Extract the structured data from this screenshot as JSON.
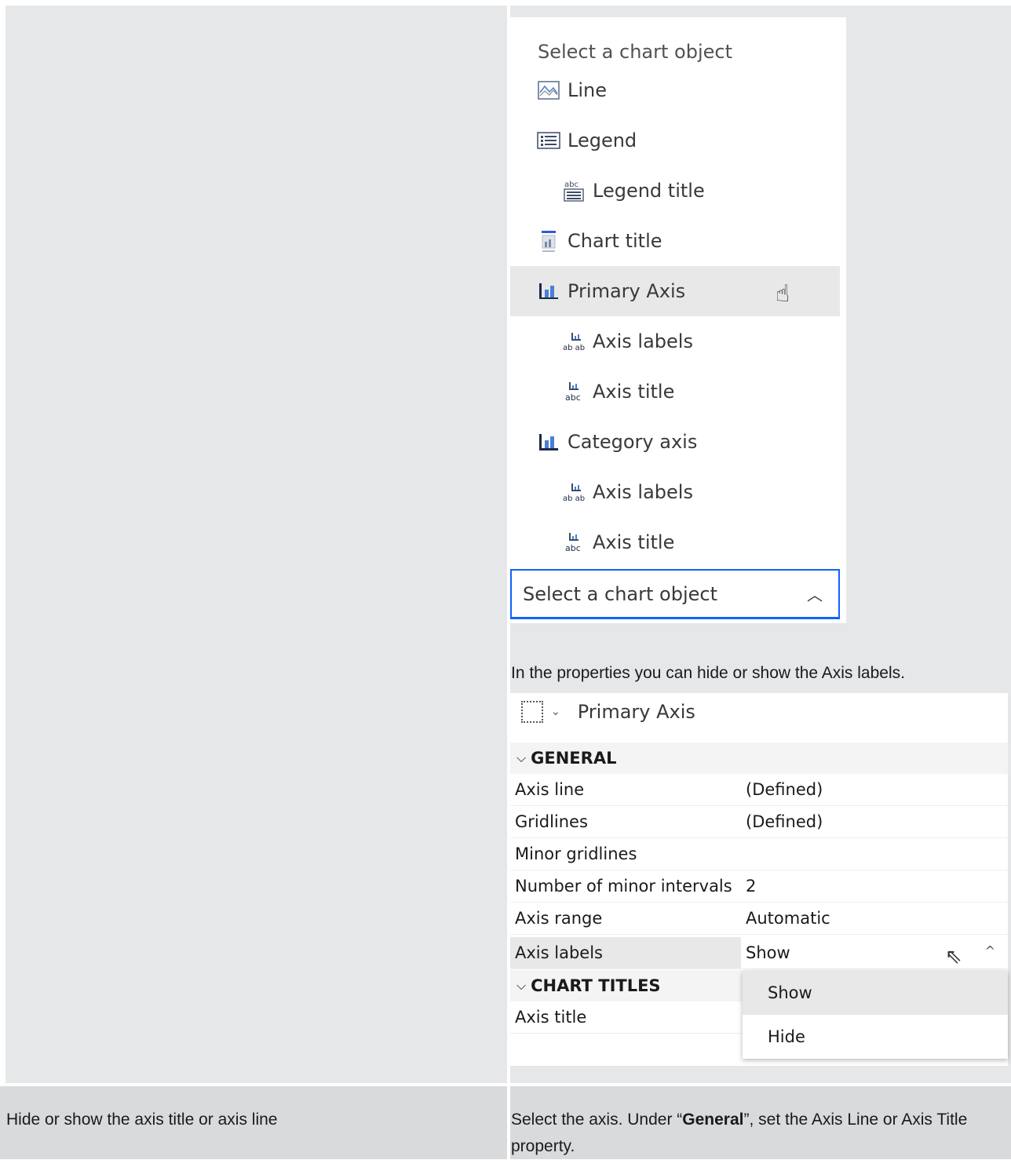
{
  "chart_object_menu": {
    "heading": "Select a chart object",
    "items": [
      {
        "label": "Line",
        "icon": "line-chart-icon"
      },
      {
        "label": "Legend",
        "icon": "legend-icon"
      },
      {
        "label": "Legend title",
        "icon": "legend-title-icon"
      },
      {
        "label": "Chart title",
        "icon": "chart-title-icon"
      },
      {
        "label": "Primary Axis",
        "icon": "bar-axis-icon"
      },
      {
        "label": "Axis labels",
        "icon": "axis-labels-icon"
      },
      {
        "label": "Axis title",
        "icon": "axis-title-icon"
      },
      {
        "label": "Category axis",
        "icon": "bar-axis-icon"
      },
      {
        "label": "Axis labels",
        "icon": "axis-labels-icon"
      },
      {
        "label": "Axis title",
        "icon": "axis-title-icon"
      }
    ],
    "select_value": "Select a chart object",
    "accent_color": "#0f62fe"
  },
  "caption": "In the properties you can hide or show the Axis labels.",
  "properties": {
    "object_name": "Primary Axis",
    "general_section": "GENERAL",
    "chart_titles_section": "CHART TITLES",
    "rows": [
      {
        "name": "Axis line",
        "value": "(Defined)"
      },
      {
        "name": "Gridlines",
        "value": "(Defined)"
      },
      {
        "name": "Minor gridlines",
        "value": ""
      },
      {
        "name": "Number of minor intervals",
        "value": "2"
      },
      {
        "name": "Axis range",
        "value": "Automatic"
      },
      {
        "name": "Axis labels",
        "value": "Show"
      }
    ],
    "title_rows": [
      {
        "name": "Axis title",
        "value": ""
      }
    ],
    "dropdown_options": [
      "Show",
      "Hide"
    ]
  },
  "row2": {
    "task": "Hide or show the axis title or axis line",
    "instruction_pre": "Select the axis. Under “",
    "instruction_bold": "General",
    "instruction_post": "”, set the Axis Line or Axis Title property."
  }
}
